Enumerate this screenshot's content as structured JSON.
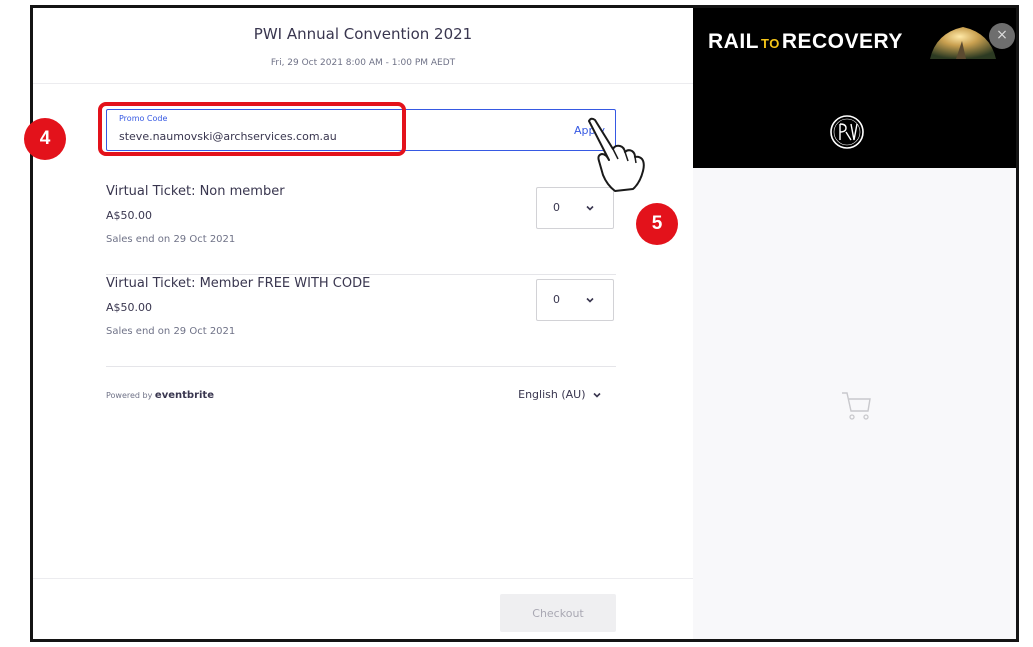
{
  "event": {
    "title": "PWI Annual Convention 2021",
    "date": "Fri, 29 Oct 2021 8:00 AM - 1:00 PM AEDT"
  },
  "promo": {
    "label": "Promo Code",
    "value": "steve.naumovski@archservices.com.au",
    "apply_label": "Apply"
  },
  "tickets": [
    {
      "name": "Virtual Ticket: Non member",
      "price": "A$50.00",
      "sales_end": "Sales end on 29 Oct 2021",
      "quantity": "0"
    },
    {
      "name": "Virtual Ticket: Member FREE WITH CODE",
      "price": "A$50.00",
      "sales_end": "Sales end on 29 Oct 2021",
      "quantity": "0"
    }
  ],
  "footer": {
    "powered_by": "Powered by",
    "brand": "eventbrite",
    "language": "English (AU)"
  },
  "checkout_label": "Checkout",
  "sidebar": {
    "banner_rail": "RAIL",
    "banner_to": "TO",
    "banner_recovery": "RECOVERY",
    "close_label": "×",
    "cart_icon": "cart-icon"
  },
  "annotations": {
    "step_4": "4",
    "step_5": "5",
    "color": "#e3121b"
  },
  "colors": {
    "accent": "#3659e3",
    "text": "#39364f",
    "muted": "#6f7287"
  }
}
